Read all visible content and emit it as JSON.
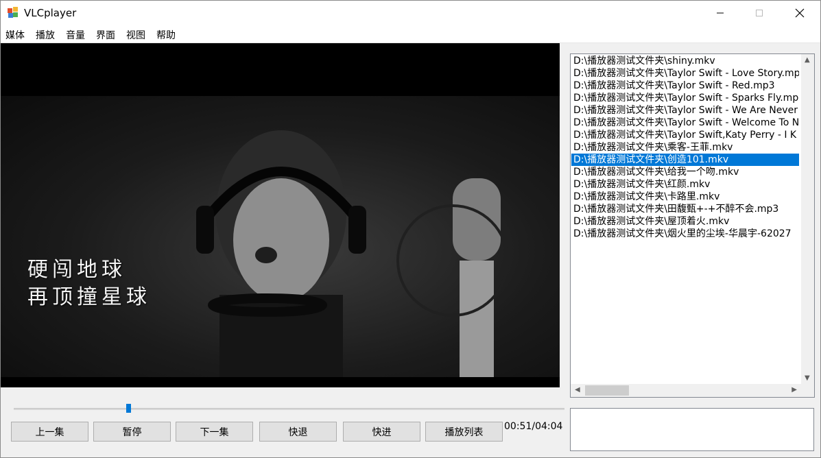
{
  "window": {
    "title": "VLCplayer",
    "icon": "vlc-app-icon"
  },
  "menu": [
    "媒体",
    "播放",
    "音量",
    "界面",
    "视图",
    "帮助"
  ],
  "video": {
    "subtitle_line1": "硬闯地球",
    "subtitle_line2": "再顶撞星球"
  },
  "playlist": {
    "items": [
      "D:\\播放器测试文件夹\\shiny.mkv",
      "D:\\播放器测试文件夹\\Taylor Swift - Love Story.mp",
      "D:\\播放器测试文件夹\\Taylor Swift - Red.mp3",
      "D:\\播放器测试文件夹\\Taylor Swift - Sparks Fly.mp",
      "D:\\播放器测试文件夹\\Taylor Swift - We Are Never",
      "D:\\播放器测试文件夹\\Taylor Swift - Welcome To N",
      "D:\\播放器测试文件夹\\Taylor Swift,Katy Perry - I K",
      "D:\\播放器测试文件夹\\乘客-王菲.mkv",
      "D:\\播放器测试文件夹\\创造101.mkv",
      "D:\\播放器测试文件夹\\给我一个吻.mkv",
      "D:\\播放器测试文件夹\\红颜.mkv",
      "D:\\播放器测试文件夹\\卡路里.mkv",
      "D:\\播放器测试文件夹\\田馥甄+-+不醉不会.mp3",
      "D:\\播放器测试文件夹\\屋顶着火.mkv",
      "D:\\播放器测试文件夹\\烟火里的尘埃-华晨宇-62027"
    ],
    "selected_index": 8
  },
  "controls": {
    "prev": "上一集",
    "pause": "暂停",
    "next": "下一集",
    "rewind": "快退",
    "forward": "快进",
    "playlist": "播放列表"
  },
  "time": "00:51/04:04",
  "seek_fraction": 0.208,
  "colors": {
    "selection": "#0078d7",
    "background": "#f0f0f0"
  }
}
